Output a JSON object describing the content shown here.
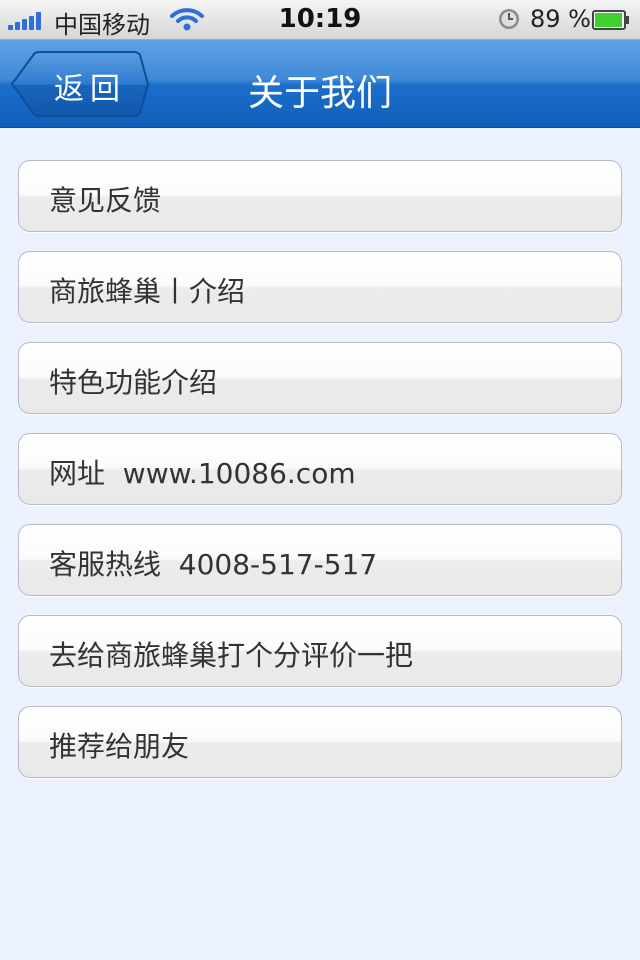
{
  "status_bar": {
    "carrier": "中国移动",
    "time": "10:19",
    "battery": "89 %"
  },
  "nav": {
    "back_label": "返回",
    "title": "关于我们"
  },
  "menu": {
    "items": [
      {
        "label": "意见反馈"
      },
      {
        "label": "商旅蜂巢丨介绍"
      },
      {
        "label": "特色功能介绍"
      },
      {
        "label": "网址  www.10086.com"
      },
      {
        "label": "客服热线  4008-517-517"
      },
      {
        "label": "去给商旅蜂巢打个分评价一把"
      },
      {
        "label": "推荐给朋友"
      }
    ]
  },
  "colors": {
    "nav_blue": "#1b6fca",
    "page_background": "#ebf1fd",
    "battery_green": "#3fd22f"
  }
}
